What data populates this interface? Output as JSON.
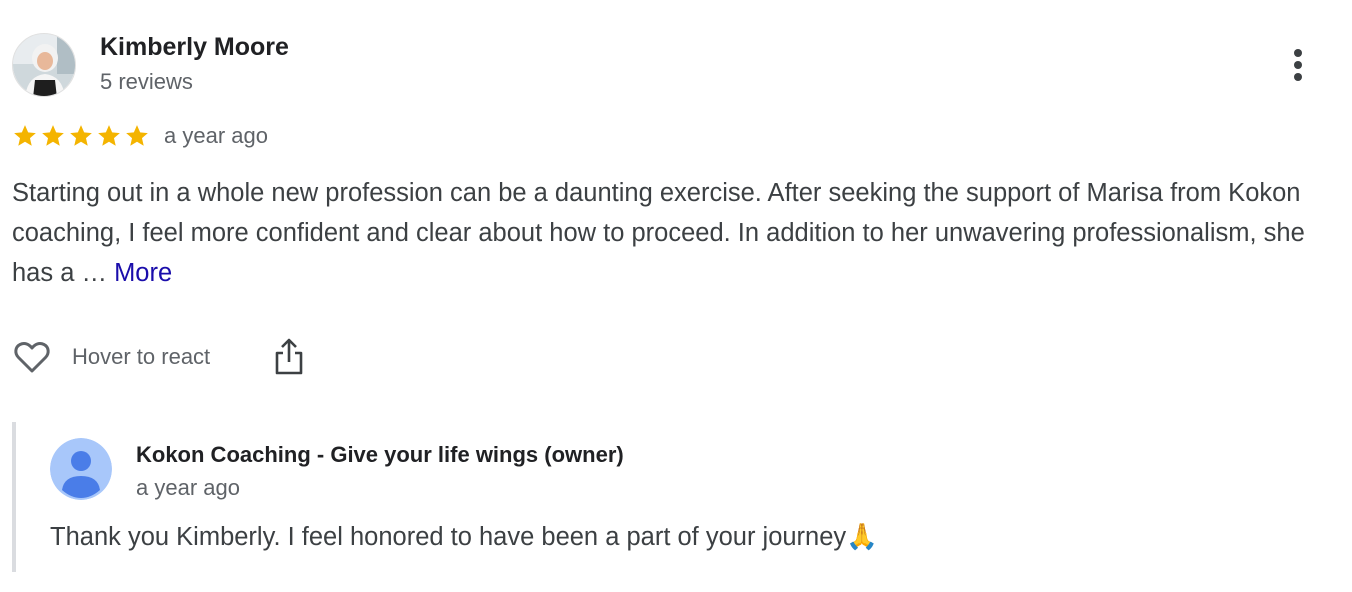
{
  "review": {
    "reviewer_name": "Kimberly Moore",
    "review_count": "5 reviews",
    "rating": 5,
    "rating_max": 5,
    "star_color": "#f4b400",
    "date": "a year ago",
    "text": "Starting out in a whole new profession can be a daunting exercise. After seeking the support of Marisa from Kokon coaching, I feel more confident and clear about how to proceed. In addition to her unwavering professionalism, she has a … ",
    "more_label": "More",
    "more_color": "#1a0dab"
  },
  "actions": {
    "react_label": "Hover to react",
    "icons": [
      "heart-icon",
      "share-icon",
      "more-vert-icon"
    ]
  },
  "owner_reply": {
    "name": "Kokon Coaching - Give your life wings (owner)",
    "date": "a year ago",
    "text": "Thank you Kimberly. I feel honored to have been a part of your journey🙏"
  }
}
